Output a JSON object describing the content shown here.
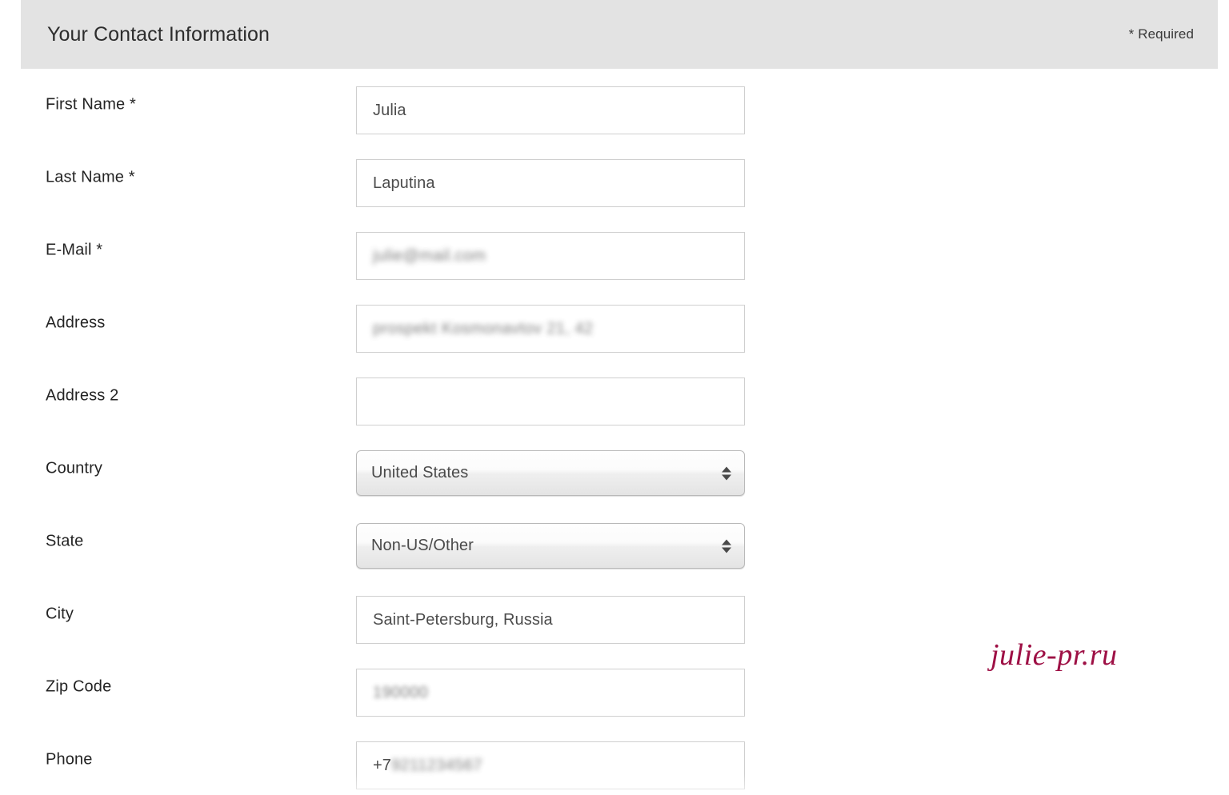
{
  "header": {
    "title": "Your Contact Information",
    "required_note": "* Required",
    "background_color": "#E3E3E3"
  },
  "watermark": {
    "text": "julie-pr.ru",
    "color": "#9E1045"
  },
  "form": {
    "fields": [
      {
        "label": "First Name *",
        "type": "text",
        "value": "Julia",
        "redacted": false,
        "name": "first-name"
      },
      {
        "label": "Last Name *",
        "type": "text",
        "value": "Laputina",
        "redacted": false,
        "name": "last-name"
      },
      {
        "label": "E-Mail *",
        "type": "text",
        "value": "julie@mail.com",
        "redacted": true,
        "name": "email"
      },
      {
        "label": "Address",
        "type": "text",
        "value": "prospekt Kosmonavtov 21, 42",
        "redacted": true,
        "name": "address"
      },
      {
        "label": "Address 2",
        "type": "text",
        "value": "",
        "redacted": false,
        "name": "address-2"
      },
      {
        "label": "Country",
        "type": "select",
        "value": "United States",
        "redacted": false,
        "name": "country"
      },
      {
        "label": "State",
        "type": "select",
        "value": "Non-US/Other",
        "redacted": false,
        "name": "state"
      },
      {
        "label": "City",
        "type": "text",
        "value": "Saint-Petersburg, Russia",
        "redacted": false,
        "name": "city"
      },
      {
        "label": "Zip Code",
        "type": "text",
        "value": "190000",
        "redacted": true,
        "name": "zip-code"
      },
      {
        "label": "Phone",
        "type": "text",
        "value": "+7",
        "value_redacted_suffix": "9211234567",
        "redacted": false,
        "name": "phone"
      }
    ]
  }
}
